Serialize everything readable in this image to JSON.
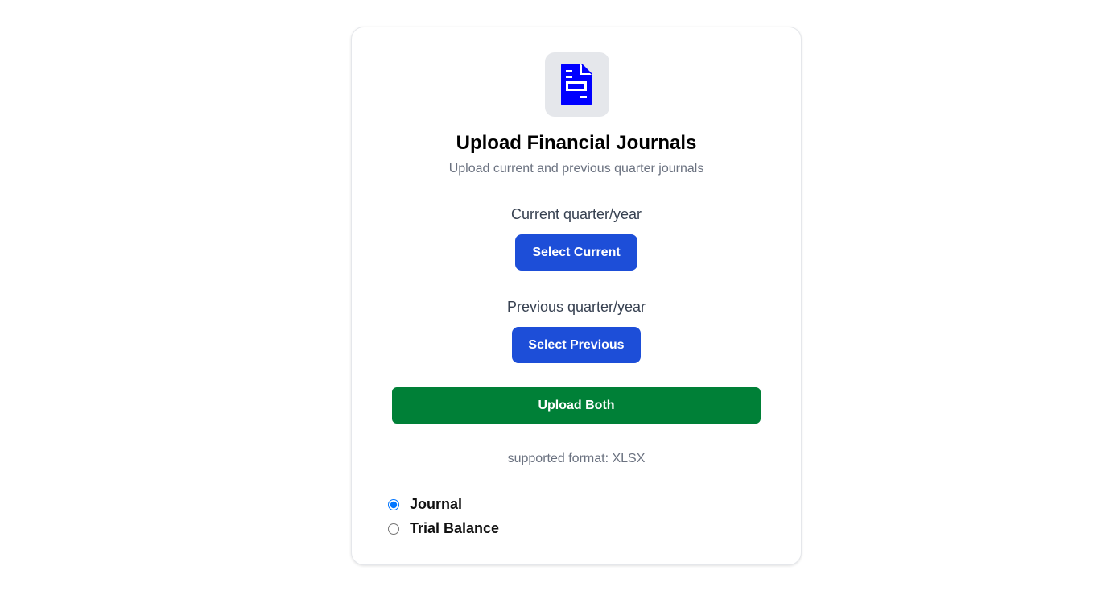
{
  "header": {
    "icon": "document-icon",
    "icon_color": "#0000ff",
    "title": "Upload Financial Journals",
    "subtitle": "Upload current and previous quarter journals"
  },
  "current": {
    "label": "Current quarter/year",
    "button_label": "Select Current"
  },
  "previous": {
    "label": "Previous quarter/year",
    "button_label": "Select Previous"
  },
  "upload": {
    "button_label": "Upload Both",
    "format_note": "supported format: XLSX"
  },
  "file_type": {
    "selected": "Journal",
    "options": [
      {
        "label": "Journal",
        "checked": true
      },
      {
        "label": "Trial Balance",
        "checked": false
      }
    ]
  },
  "colors": {
    "primary_button": "#1d4ed8",
    "upload_button": "#008037",
    "muted_text": "#6b7280"
  }
}
